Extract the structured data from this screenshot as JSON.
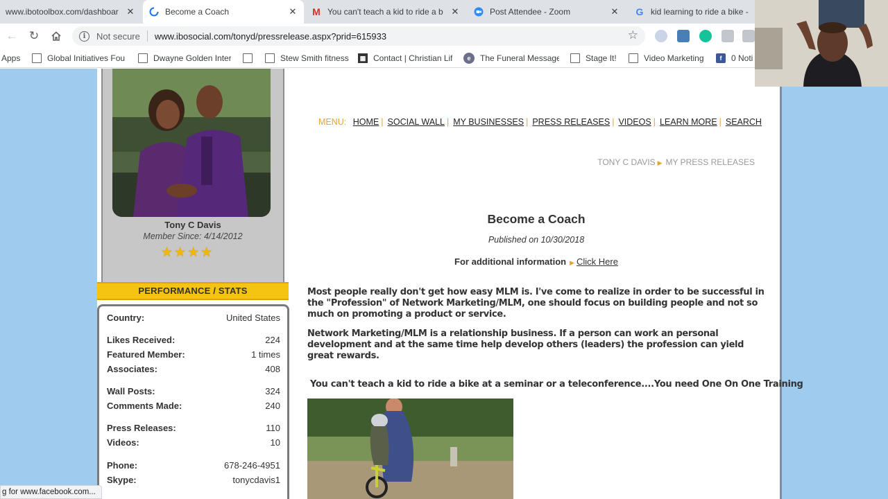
{
  "browser": {
    "tabs": [
      {
        "title": "www.ibotoolbox.com/dashboar",
        "favicon": "",
        "active": false
      },
      {
        "title": "Become a Coach",
        "favicon": "loading-icon",
        "active": true
      },
      {
        "title": "You can't teach a kid to ride a b",
        "favicon": "gmail-icon",
        "active": false
      },
      {
        "title": "Post Attendee - Zoom",
        "favicon": "zoom-icon",
        "active": false
      },
      {
        "title": "kid learning to ride a bike - G",
        "favicon": "google-icon",
        "active": false
      }
    ],
    "omnibox": {
      "security": "Not secure",
      "url": "www.ibosocial.com/tonyd/pressrelease.aspx?prid=615933"
    },
    "bookmarks": [
      {
        "label": "Apps",
        "icon": "apps-grid-icon"
      },
      {
        "label": "Global Initiatives Fou",
        "icon": "page-icon"
      },
      {
        "label": "Dwayne Golden Inter",
        "icon": "page-icon"
      },
      {
        "label": "",
        "icon": "page-icon"
      },
      {
        "label": "Stew Smith fitness",
        "icon": "page-icon"
      },
      {
        "label": "Contact | Christian Lif",
        "icon": "film-icon"
      },
      {
        "label": "The Funeral Message",
        "icon": "circle-logo-icon"
      },
      {
        "label": "Stage It!",
        "icon": "page-icon"
      },
      {
        "label": "Video Marketing",
        "icon": "page-icon"
      },
      {
        "label": "0 Noti",
        "icon": "facebook-icon"
      }
    ],
    "status_bar": "g for www.facebook.com..."
  },
  "profile": {
    "name": "Tony C Davis",
    "member_since": "Member Since: 4/14/2012",
    "star_rating": 4,
    "stars": "★ ★ ★ ★"
  },
  "stats": {
    "heading": "PERFORMANCE / STATS",
    "rows": [
      {
        "label": "Country:",
        "value": "United States"
      },
      {
        "label": "Likes Received:",
        "value": "224"
      },
      {
        "label": "Featured Member:",
        "value": "1 times"
      },
      {
        "label": "Associates:",
        "value": "408"
      },
      {
        "label": "Wall Posts:",
        "value": "324"
      },
      {
        "label": "Comments Made:",
        "value": "240"
      },
      {
        "label": "Press Releases:",
        "value": "110"
      },
      {
        "label": "Videos:",
        "value": "10"
      },
      {
        "label": "Phone:",
        "value": "678-246-4951"
      },
      {
        "label": "Skype:",
        "value": "tonycdavis1"
      }
    ]
  },
  "menu": {
    "label": "MENU:",
    "items": [
      "HOME",
      "SOCIAL WALL",
      "MY BUSINESSES",
      "PRESS RELEASES",
      "VIDEOS",
      "LEARN MORE",
      "SEARCH"
    ]
  },
  "breadcrumb": {
    "user": "TONY C DAVIS",
    "section": "MY PRESS RELEASES"
  },
  "press_release": {
    "title": "Become a Coach",
    "published": "Published on 10/30/2018",
    "additional_info_label": "For additional information",
    "additional_info_link": "Click Here",
    "paragraphs": [
      "Most people really don't get how easy MLM is.  I've come to realize in order to be successful in the \"Profession\" of Network Marketing/MLM, one should focus on building people and not so much on promoting a product or service.",
      "Network Marketing/MLM is a relationship business. If a person can work an personal development and at the same time help develop others (leaders) the profession can yield great rewards."
    ],
    "subheading": "You can't teach a kid to ride a bike at a seminar or a teleconference....You need One On One Training"
  },
  "colors": {
    "page_background": "#9fcbef",
    "menu_accent": "#e3a33b",
    "stats_banner": "#f5c312"
  }
}
